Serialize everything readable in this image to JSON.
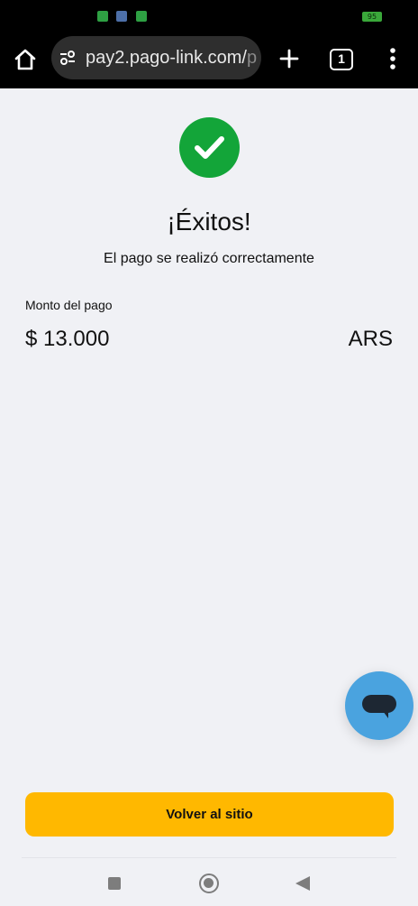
{
  "status_bar": {
    "notification_icons": [
      "notification-icon-1",
      "notification-icon-2",
      "notification-icon-3"
    ],
    "battery_level": "95"
  },
  "browser": {
    "url_main": "pay2.pago-link.com/",
    "url_faded": "p",
    "tab_count": "1",
    "icons": [
      "home-icon",
      "tune-icon",
      "plus-icon",
      "tabs-icon",
      "more-vert-icon"
    ]
  },
  "result": {
    "title": "¡Éxitos!",
    "subtitle": "El pago se realizó correctamente",
    "status_color": "#13a539"
  },
  "payment": {
    "amount_label": "Monto del pago",
    "amount": "$ 13.000",
    "currency": "ARS"
  },
  "chat": {
    "icon": "chat-icon",
    "color": "#4aa3df"
  },
  "actions": {
    "back_label": "Volver al sitio",
    "button_color": "#ffb800"
  },
  "nav": {
    "icons": [
      "recents-icon",
      "home-circle-icon",
      "back-icon"
    ]
  }
}
